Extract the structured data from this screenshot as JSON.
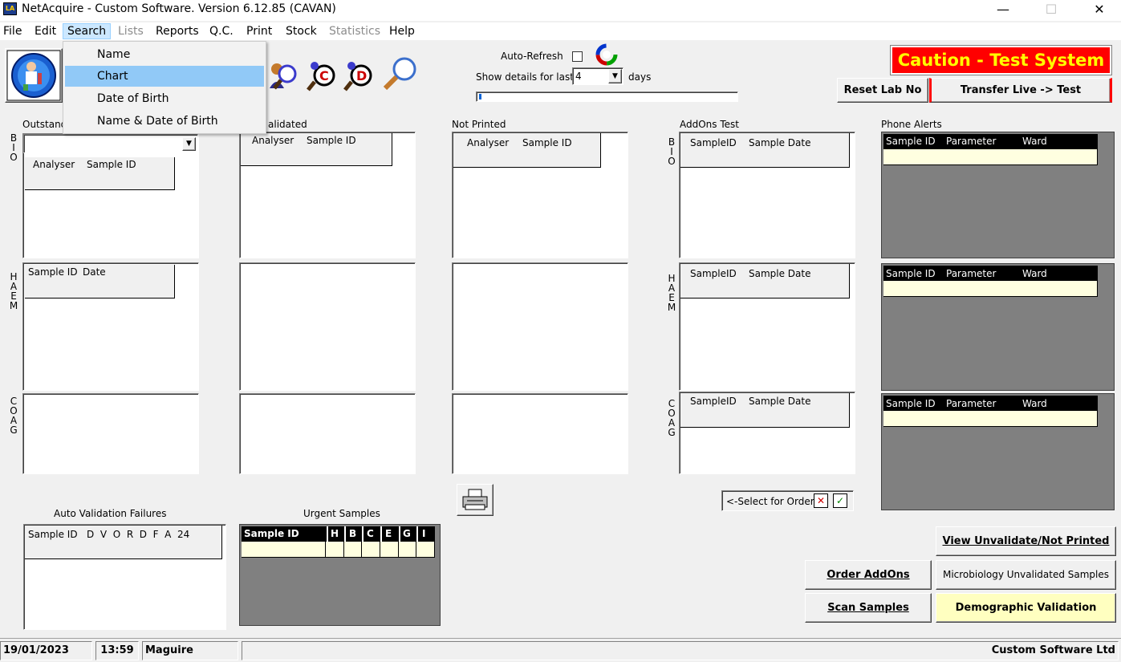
{
  "window": {
    "icon_text": "LA",
    "title": "NetAcquire - Custom Software. Version 6.12.85 (CAVAN)",
    "minimize": "—",
    "maximize": "☐",
    "close": "✕"
  },
  "menu": {
    "file": "File",
    "edit": "Edit",
    "search": "Search",
    "lists": "Lists",
    "reports": "Reports",
    "qc": "Q.C.",
    "print": "Print",
    "stock": "Stock",
    "statistics": "Statistics",
    "help": "Help"
  },
  "search_menu": {
    "items": [
      "Name",
      "Chart",
      "Date of Birth",
      "Name & Date of Birth"
    ],
    "highlighted": "Chart"
  },
  "toolbar": {
    "auto_refresh_label": "Auto-Refresh",
    "show_details_label": "Show details for last",
    "days_value": "4",
    "days_label": "days",
    "caution_banner": "Caution - Test System",
    "reset_lab_no": "Reset Lab No",
    "transfer_live_test": "Transfer Live -> Test"
  },
  "sections": {
    "outstanding": "Outstand",
    "validated": "alidated",
    "not_printed": "Not Printed",
    "addons_test": "AddOns Test",
    "phone_alerts": "Phone Alerts",
    "auto_validation_failures": "Auto Validation Failures",
    "urgent_samples": "Urgent Samples"
  },
  "row_labels": {
    "bio": [
      "B",
      "I",
      "O"
    ],
    "haem": [
      "H",
      "A",
      "E",
      "M"
    ],
    "coag": [
      "C",
      "O",
      "A",
      "G"
    ]
  },
  "grid_headers": {
    "outstanding_bio": [
      "Analyser",
      "Sample ID"
    ],
    "outstanding_haem": [
      "Sample ID",
      "Date"
    ],
    "validated_bio": [
      "Analyser",
      "Sample ID"
    ],
    "not_printed_bio": [
      "Analyser",
      "Sample ID"
    ],
    "addons": [
      "SampleID",
      "Sample Date"
    ],
    "phone_alerts": [
      "Sample ID",
      "Parameter",
      "Ward"
    ],
    "auto_validation": "Sample ID   D  V  O  R  D  F  A  24",
    "urgent": [
      "Sample ID",
      "H",
      "B",
      "C",
      "E",
      "G",
      "I"
    ]
  },
  "select_for_order": "<-Select for Order",
  "buttons": {
    "view_unvalidate": "View Unvalidate/Not Printed",
    "order_addons": "Order AddOns",
    "micro_unvalidated": "Microbiology Unvalidated Samples",
    "scan_samples": "Scan Samples",
    "demographic_validation": "Demographic Validation"
  },
  "status": {
    "date": "19/01/2023",
    "time": "13:59",
    "user": "Maguire Carmel",
    "company": "Custom Software Ltd"
  },
  "colors": {
    "caution_bg": "#ff0000",
    "caution_text": "#ffff00",
    "highlight_menu": "#91c9f7",
    "demographic_bg": "#ffffc0",
    "grid_dark": "#808080"
  }
}
